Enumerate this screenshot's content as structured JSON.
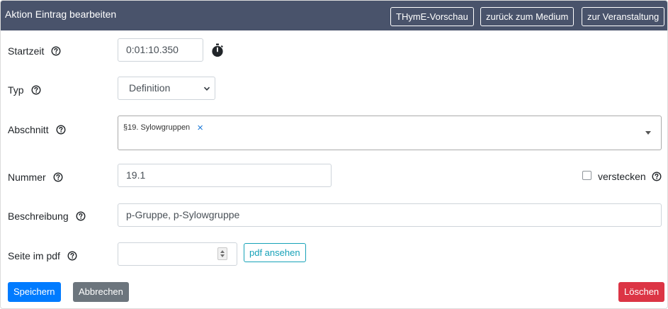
{
  "header": {
    "title": "Aktion Eintrag bearbeiten",
    "buttons": {
      "thyme_preview": "THymE-Vorschau",
      "back_to_medium": "zurück zum Medium",
      "to_event": "zur Veranstaltung"
    }
  },
  "form": {
    "start_time": {
      "label": "Startzeit",
      "value": "0:01:10.350",
      "icon": "stopwatch-icon"
    },
    "type": {
      "label": "Typ",
      "selected": "Definition"
    },
    "section": {
      "label": "Abschnitt",
      "selected_tags": [
        "§19. Sylowgruppen"
      ]
    },
    "number": {
      "label": "Nummer",
      "value": "19.1"
    },
    "hide": {
      "label": "verstecken",
      "checked": false
    },
    "description": {
      "label": "Beschreibung",
      "value": "p-Gruppe, p-Sylowgruppe"
    },
    "pdf_page": {
      "label": "Seite im pdf",
      "value": "",
      "view_button": "pdf ansehen"
    }
  },
  "actions": {
    "save": "Speichern",
    "cancel": "Abbrechen",
    "delete": "Löschen"
  },
  "colors": {
    "header_bg": "#49536b",
    "primary": "#007bff",
    "secondary": "#6c757d",
    "danger": "#dc3545",
    "info": "#17a2b8"
  }
}
